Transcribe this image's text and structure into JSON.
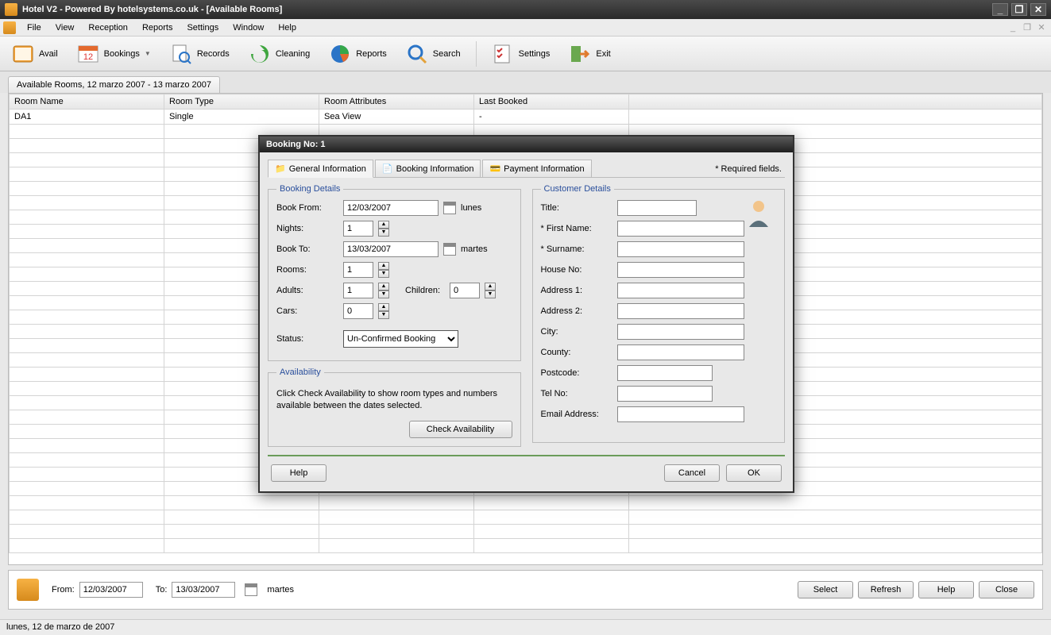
{
  "titlebar": {
    "title": "Hotel V2 - Powered By hotelsystems.co.uk - [Available Rooms]"
  },
  "menu": {
    "items": [
      "File",
      "View",
      "Reception",
      "Reports",
      "Settings",
      "Window",
      "Help"
    ]
  },
  "toolbar": {
    "avail": "Avail",
    "bookings": "Bookings",
    "records": "Records",
    "cleaning": "Cleaning",
    "reports": "Reports",
    "search": "Search",
    "settings": "Settings",
    "exit": "Exit"
  },
  "tab": {
    "title": "Available Rooms, 12 marzo 2007 - 13 marzo 2007"
  },
  "table": {
    "headers": [
      "Room Name",
      "Room Type",
      "Room Attributes",
      "Last Booked"
    ],
    "row": {
      "room_name": "DA1",
      "room_type": "Single",
      "room_attributes": "Sea View",
      "last_booked": "-"
    }
  },
  "modal": {
    "title": "Booking No: 1",
    "tabs": {
      "general": "General Information",
      "booking": "Booking Information",
      "payment": "Payment Information"
    },
    "required_note": "*  Required fields.",
    "booking_details": {
      "legend": "Booking Details",
      "book_from_label": "Book From:",
      "book_from": "12/03/2007",
      "book_from_day": "lunes",
      "nights_label": "Nights:",
      "nights": "1",
      "book_to_label": "Book To:",
      "book_to": "13/03/2007",
      "book_to_day": "martes",
      "rooms_label": "Rooms:",
      "rooms": "1",
      "adults_label": "Adults:",
      "adults": "1",
      "children_label": "Children:",
      "children": "0",
      "cars_label": "Cars:",
      "cars": "0",
      "status_label": "Status:",
      "status_value": "Un-Confirmed Booking"
    },
    "availability": {
      "legend": "Availability",
      "text": "Click Check Availability to show room types and numbers available between the dates selected.",
      "button": "Check Availability"
    },
    "customer": {
      "legend": "Customer Details",
      "title_label": "Title:",
      "first_name_label": "* First Name:",
      "surname_label": "* Surname:",
      "house_no_label": "House No:",
      "address1_label": "Address 1:",
      "address2_label": "Address 2:",
      "city_label": "City:",
      "county_label": "County:",
      "postcode_label": "Postcode:",
      "tel_label": "Tel No:",
      "email_label": "Email Address:"
    },
    "buttons": {
      "help": "Help",
      "cancel": "Cancel",
      "ok": "OK"
    }
  },
  "bottom": {
    "from_label": "From:",
    "from": "12/03/2007",
    "to_label": "To:",
    "to": "13/03/2007",
    "day": "martes",
    "select": "Select",
    "refresh": "Refresh",
    "help": "Help",
    "close": "Close"
  },
  "statusbar": {
    "text": "lunes, 12 de marzo de 2007"
  }
}
